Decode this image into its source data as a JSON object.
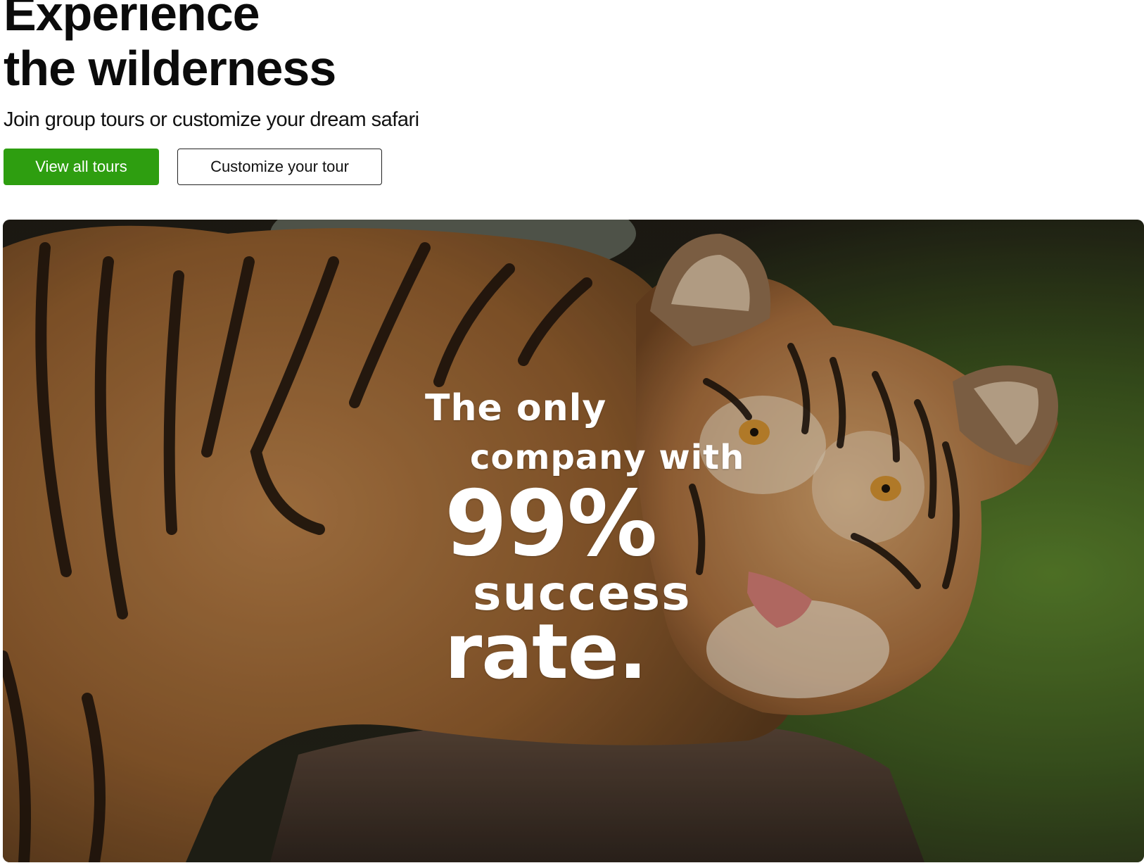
{
  "hero": {
    "headline_line1": "Experience",
    "headline_line2": "the wilderness",
    "subtitle": "Join group tours or customize your dream safari"
  },
  "buttons": {
    "primary_label": "View all tours",
    "secondary_label": "Customize your tour"
  },
  "colors": {
    "primary_button": "#2e9e10",
    "text": "#0b0b0b",
    "background": "#ffffff"
  },
  "banner": {
    "image_subject": "tiger-photo",
    "line1": "The only",
    "line2": "company with",
    "line3": "99%",
    "line4": "success",
    "line5": "rate."
  }
}
